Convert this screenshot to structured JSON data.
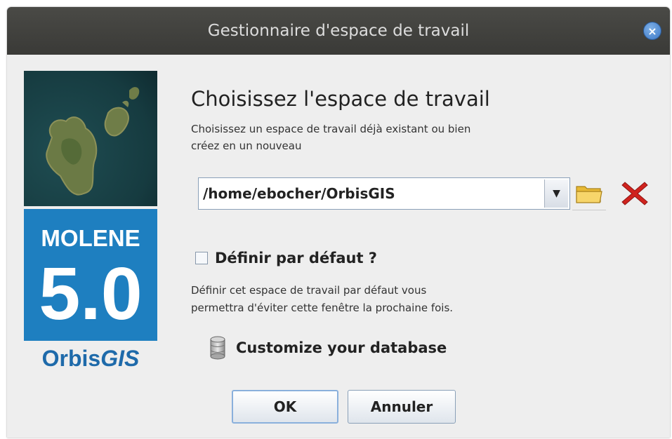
{
  "window": {
    "title": "Gestionnaire d'espace de travail",
    "close_label": "×"
  },
  "splash": {
    "product": "MOLENE",
    "version": "5.0",
    "brand_prefix": "Orbis",
    "brand_suffix": "GIS"
  },
  "main": {
    "heading": "Choisissez l'espace de travail",
    "description_line1": "Choisissez un espace de travail déjà existant ou bien",
    "description_line2": "créez en un nouveau",
    "workspace_path": "/home/ebocher/OrbisGIS",
    "default_checkbox_label": "Définir par défaut ?",
    "default_checked": false,
    "default_help_line1": "Définir cet espace de travail par défaut vous",
    "default_help_line2": "permettra d'éviter cette fenêtre la prochaine fois.",
    "database_label": "Customize your database"
  },
  "buttons": {
    "ok": "OK",
    "cancel": "Annuler"
  },
  "icons": {
    "folder": "folder-icon",
    "remove": "remove-icon",
    "database": "database-icon",
    "dropdown": "chevron-down-icon"
  },
  "colors": {
    "titlebar": "#3f3f3c",
    "splash_blue": "#1e7fc0",
    "brand_blue": "#1e6aaa",
    "remove_red": "#d0231e"
  }
}
